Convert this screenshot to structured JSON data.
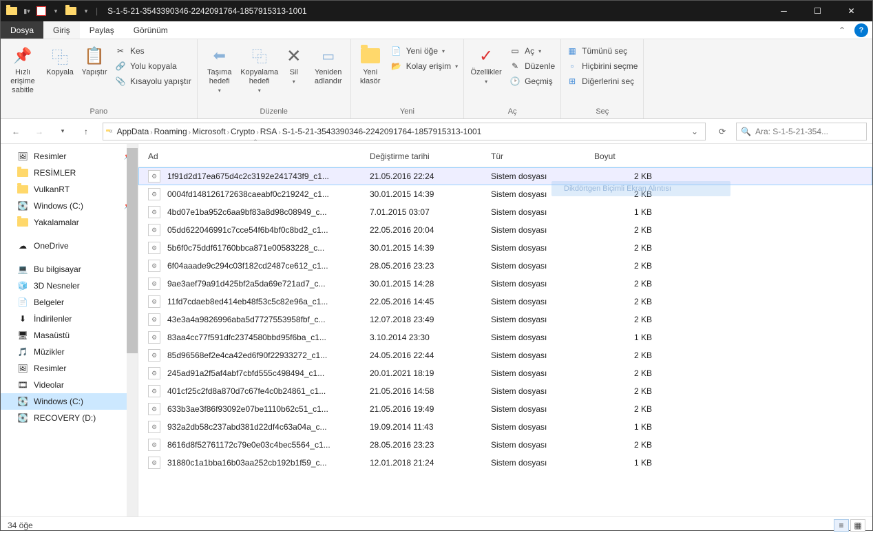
{
  "window": {
    "title": "S-1-5-21-3543390346-2242091764-1857915313-1001"
  },
  "tabs": {
    "file": "Dosya",
    "home": "Giriş",
    "share": "Paylaş",
    "view": "Görünüm"
  },
  "ribbon": {
    "clipboard": {
      "pin": "Hızlı erişime\nsabitle",
      "copy": "Kopyala",
      "paste": "Yapıştır",
      "cut": "Kes",
      "copypath": "Yolu kopyala",
      "pasteshortcut": "Kısayolu yapıştır",
      "label": "Pano"
    },
    "organize": {
      "moveto": "Taşıma\nhedefi",
      "copyto": "Kopyalama\nhedefi",
      "delete": "Sil",
      "rename": "Yeniden\nadlandır",
      "label": "Düzenle"
    },
    "new": {
      "newfolder": "Yeni\nklasör",
      "newitem": "Yeni öğe",
      "easyaccess": "Kolay erişim",
      "label": "Yeni"
    },
    "open": {
      "properties": "Özellikler",
      "open": "Aç",
      "edit": "Düzenle",
      "history": "Geçmiş",
      "label": "Aç"
    },
    "select": {
      "selectall": "Tümünü seç",
      "selectnone": "Hiçbirini seçme",
      "invert": "Diğerlerini seç",
      "label": "Seç"
    }
  },
  "breadcrumb": [
    "AppData",
    "Roaming",
    "Microsoft",
    "Crypto",
    "RSA",
    "S-1-5-21-3543390346-2242091764-1857915313-1001"
  ],
  "search": {
    "placeholder": "Ara: S-1-5-21-354..."
  },
  "sidebar": [
    {
      "label": "Resimler",
      "icon": "pic",
      "pin": true
    },
    {
      "label": "RESİMLER",
      "icon": "folder"
    },
    {
      "label": "VulkanRT",
      "icon": "folder"
    },
    {
      "label": "Windows (C:)",
      "icon": "drive",
      "pin": true
    },
    {
      "label": "Yakalamalar",
      "icon": "folder"
    },
    {
      "label": "",
      "spacer": true
    },
    {
      "label": "OneDrive",
      "icon": "onedrive"
    },
    {
      "label": "",
      "spacer": true
    },
    {
      "label": "Bu bilgisayar",
      "icon": "pc"
    },
    {
      "label": "3D Nesneler",
      "icon": "3d"
    },
    {
      "label": "Belgeler",
      "icon": "doc"
    },
    {
      "label": "İndirilenler",
      "icon": "dl"
    },
    {
      "label": "Masaüstü",
      "icon": "desk"
    },
    {
      "label": "Müzikler",
      "icon": "music"
    },
    {
      "label": "Resimler",
      "icon": "pic"
    },
    {
      "label": "Videolar",
      "icon": "vid"
    },
    {
      "label": "Windows (C:)",
      "icon": "drive",
      "selected": true
    },
    {
      "label": "RECOVERY (D:)",
      "icon": "drive"
    }
  ],
  "columns": {
    "name": "Ad",
    "date": "Değiştirme tarihi",
    "type": "Tür",
    "size": "Boyut"
  },
  "files": [
    {
      "n": "1f91d2d17ea675d4c2c3192e241743f9_c1...",
      "d": "21.05.2016 22:24",
      "t": "Sistem dosyası",
      "s": "2 KB",
      "sel": true
    },
    {
      "n": "0004fd148126172638caeabf0c219242_c1...",
      "d": "30.01.2015 14:39",
      "t": "Sistem dosyası",
      "s": "2 KB"
    },
    {
      "n": "4bd07e1ba952c6aa9bf83a8d98c08949_c...",
      "d": "7.01.2015 03:07",
      "t": "Sistem dosyası",
      "s": "1 KB"
    },
    {
      "n": "05dd622046991c7cce54f6b4bf0c8bd2_c1...",
      "d": "22.05.2016 20:04",
      "t": "Sistem dosyası",
      "s": "2 KB"
    },
    {
      "n": "5b6f0c75ddf61760bbca871e00583228_c...",
      "d": "30.01.2015 14:39",
      "t": "Sistem dosyası",
      "s": "2 KB"
    },
    {
      "n": "6f04aaade9c294c03f182cd2487ce612_c1...",
      "d": "28.05.2016 23:23",
      "t": "Sistem dosyası",
      "s": "2 KB"
    },
    {
      "n": "9ae3aef79a91d425bf2a5da69e721ad7_c...",
      "d": "30.01.2015 14:28",
      "t": "Sistem dosyası",
      "s": "2 KB"
    },
    {
      "n": "11fd7cdaeb8ed414eb48f53c5c82e96a_c1...",
      "d": "22.05.2016 14:45",
      "t": "Sistem dosyası",
      "s": "2 KB"
    },
    {
      "n": "43e3a4a9826996aba5d7727553958fbf_c...",
      "d": "12.07.2018 23:49",
      "t": "Sistem dosyası",
      "s": "2 KB"
    },
    {
      "n": "83aa4cc77f591dfc2374580bbd95f6ba_c1...",
      "d": "3.10.2014 23:30",
      "t": "Sistem dosyası",
      "s": "1 KB"
    },
    {
      "n": "85d96568ef2e4ca42ed6f90f22933272_c1...",
      "d": "24.05.2016 22:44",
      "t": "Sistem dosyası",
      "s": "2 KB"
    },
    {
      "n": "245ad91a2f5af4abf7cbfd555c498494_c1...",
      "d": "20.01.2021 18:19",
      "t": "Sistem dosyası",
      "s": "2 KB"
    },
    {
      "n": "401cf25c2fd8a870d7c67fe4c0b24861_c1...",
      "d": "21.05.2016 14:58",
      "t": "Sistem dosyası",
      "s": "2 KB"
    },
    {
      "n": "633b3ae3f86f93092e07be1110b62c51_c1...",
      "d": "21.05.2016 19:49",
      "t": "Sistem dosyası",
      "s": "2 KB"
    },
    {
      "n": "932a2db58c237abd381d22df4c63a04a_c...",
      "d": "19.09.2014 11:43",
      "t": "Sistem dosyası",
      "s": "1 KB"
    },
    {
      "n": "8616d8f52761172c79e0e03c4bec5564_c1...",
      "d": "28.05.2016 23:23",
      "t": "Sistem dosyası",
      "s": "2 KB"
    },
    {
      "n": "31880c1a1bba16b03aa252cb192b1f59_c...",
      "d": "12.01.2018 21:24",
      "t": "Sistem dosyası",
      "s": "1 KB"
    }
  ],
  "snip_label": "Dikdörtgen Biçimli Ekran Alıntısı",
  "status": {
    "count": "34 öğe"
  }
}
